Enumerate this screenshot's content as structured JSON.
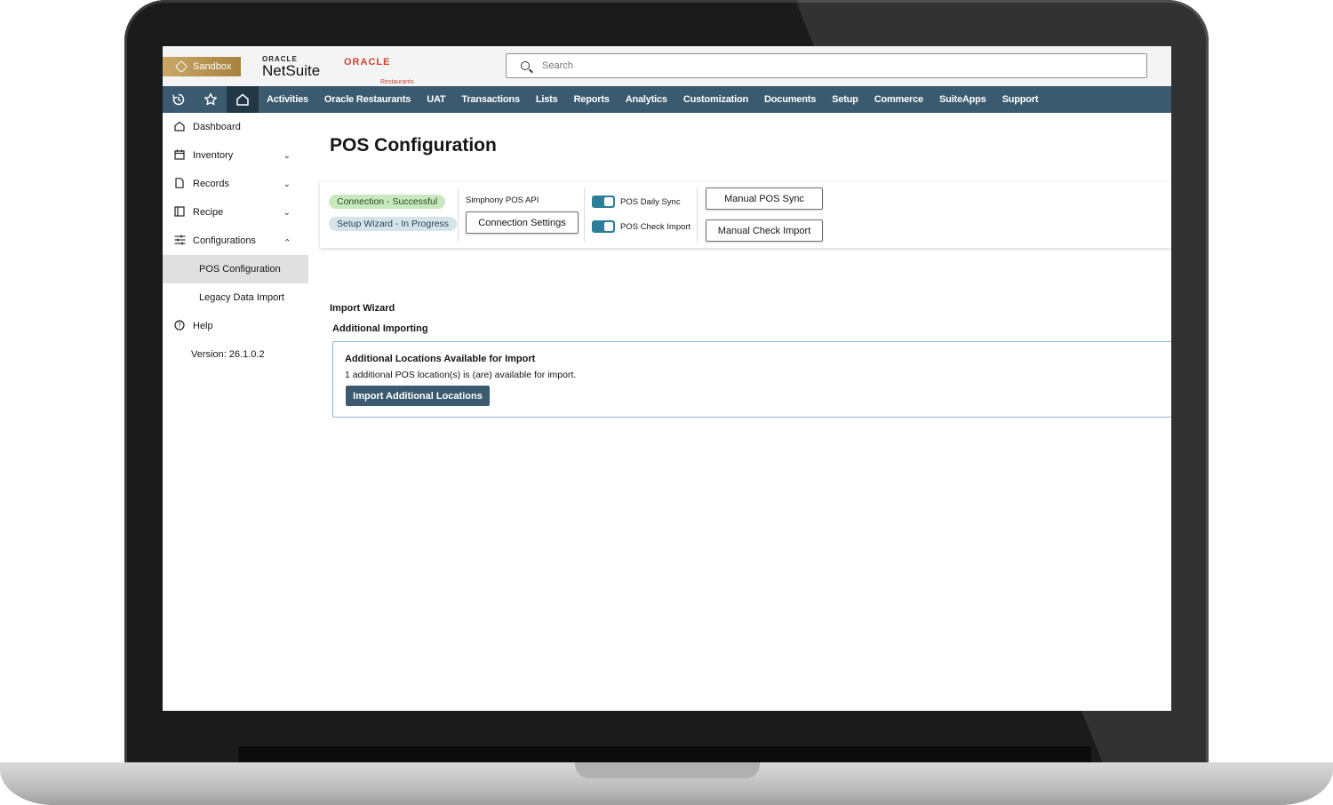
{
  "header": {
    "sandbox_label": "Sandbox",
    "netsuite_small": "ORACLE",
    "netsuite_big": "NetSuite",
    "oracle_restaurants_small": "ORACLE",
    "oracle_restaurants_sub": "Restaurants",
    "search_placeholder": "Search"
  },
  "nav": {
    "items": [
      "Activities",
      "Oracle Restaurants",
      "UAT",
      "Transactions",
      "Lists",
      "Reports",
      "Analytics",
      "Customization",
      "Documents",
      "Setup",
      "Commerce",
      "SuiteApps",
      "Support"
    ]
  },
  "sidebar": {
    "dashboard": "Dashboard",
    "inventory": "Inventory",
    "records": "Records",
    "recipe": "Recipe",
    "configurations": "Configurations",
    "pos_configuration": "POS Configuration",
    "legacy_data_import": "Legacy Data Import",
    "help": "Help",
    "version": "Version: 26.1.0.2"
  },
  "main": {
    "title": "POS Configuration",
    "status_connection": "Connection - Successful",
    "status_wizard": "Setup Wizard - In Progress",
    "api_label": "Simphony POS API",
    "connection_settings": "Connection Settings",
    "toggle_daily_sync": "POS Daily Sync",
    "toggle_check_import": "POS Check Import",
    "manual_pos_sync": "Manual POS Sync",
    "manual_check_import": "Manual Check Import",
    "import_wizard": "Import Wizard",
    "additional_importing": "Additional Importing",
    "card_heading": "Additional Locations Available for Import",
    "card_desc": "1 additional POS location(s) is (are) available for import.",
    "import_button": "Import Additional Locations"
  },
  "colors": {
    "nav_bg": "#3b5a6f",
    "nav_active": "#223847",
    "toggle_on": "#2e7e98",
    "success_pill": "#c8e8bf",
    "progress_pill": "#d3e5ea",
    "sandbox_gold": "#b8954f"
  }
}
